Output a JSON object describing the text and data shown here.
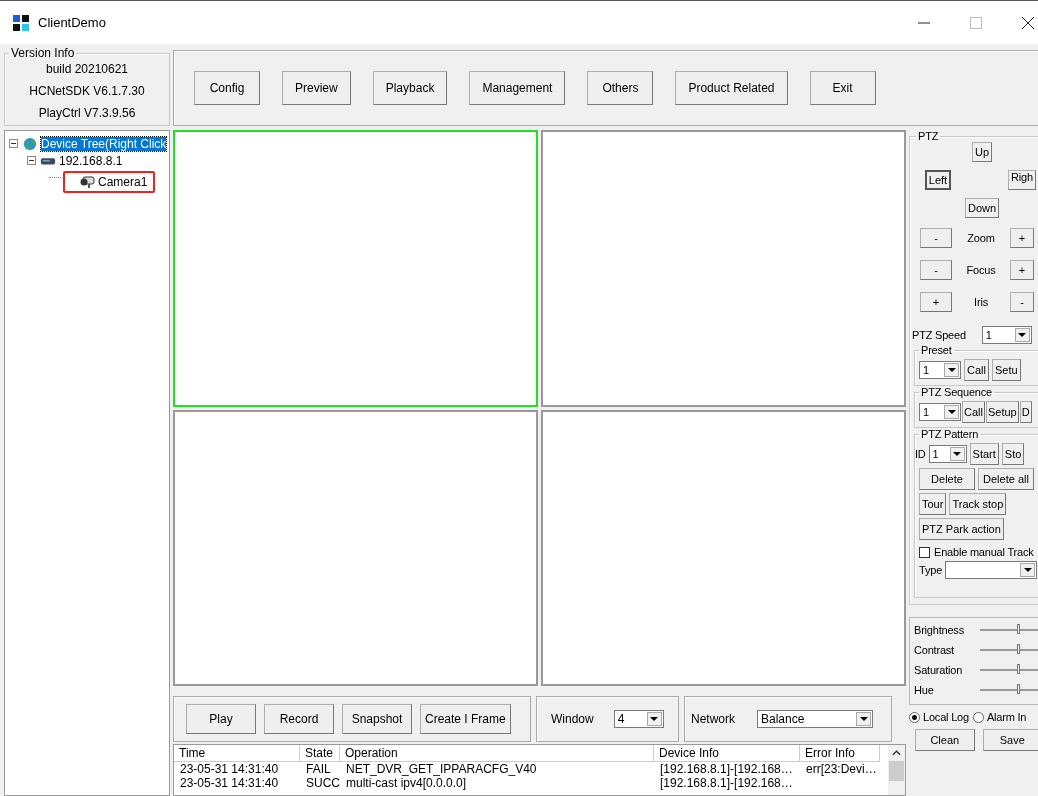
{
  "window": {
    "title": "ClientDemo"
  },
  "version_info": {
    "title": "Version Info",
    "lines": [
      "build 20210621",
      "HCNetSDK V6.1.7.30",
      "PlayCtrl V7.3.9.56"
    ]
  },
  "toolbar": [
    "Config",
    "Preview",
    "Playback",
    "Management",
    "Others",
    "Product Related",
    "Exit"
  ],
  "device_tree": [
    {
      "label": "Device Tree(Right Click",
      "kind": "root",
      "selected": true,
      "highlighted": false,
      "children": [
        {
          "label": "192.168.8.1",
          "kind": "device",
          "selected": false,
          "highlighted": false,
          "children": [
            {
              "label": "Camera1",
              "kind": "camera",
              "selected": false,
              "highlighted": true
            }
          ]
        }
      ]
    }
  ],
  "video_panes": [
    {
      "selected": true
    },
    {
      "selected": false
    },
    {
      "selected": false
    },
    {
      "selected": false
    }
  ],
  "preview_buttons": [
    "Play",
    "Record",
    "Snapshot",
    "Create I Frame"
  ],
  "window_select": {
    "label": "Window",
    "value": "4"
  },
  "network_select": {
    "label": "Network",
    "value": "Balance"
  },
  "log_table": {
    "columns": [
      "Time",
      "State",
      "Operation",
      "Device Info",
      "Error Info"
    ],
    "rows": [
      [
        "23-05-31 14:31:40",
        "FAIL",
        "NET_DVR_GET_IPPARACFG_V40",
        "[192.168.8.1]-[192.168…",
        "err[23:Devi…"
      ],
      [
        "23-05-31 14:31:40",
        "SUCC",
        "multi-cast ipv4[0.0.0.0]",
        "[192.168.8.1]-[192.168…",
        ""
      ]
    ]
  },
  "ptz": {
    "title": "PTZ",
    "directions": [
      {
        "label": "Up",
        "focused": false
      },
      {
        "label": "Left",
        "focused": true
      },
      {
        "label": "Righ",
        "focused": false
      },
      {
        "label": "Down",
        "focused": false
      }
    ],
    "adjust": [
      {
        "left": "-",
        "label": "Zoom",
        "right": "+"
      },
      {
        "left": "-",
        "label": "Focus",
        "right": "+"
      },
      {
        "left": "+",
        "label": "Iris",
        "right": "-"
      }
    ],
    "speed": {
      "label": "PTZ Speed",
      "value": "1"
    },
    "preset": {
      "title": "Preset",
      "value": "1",
      "buttons": [
        "Call",
        "Setu"
      ]
    },
    "sequence": {
      "title": "PTZ Sequence",
      "value": "1",
      "buttons": [
        "Call",
        "Setup",
        "D"
      ]
    },
    "pattern": {
      "title": "PTZ Pattern",
      "id_label": "ID",
      "value": "1",
      "row1": [
        "Start",
        "Sto"
      ],
      "row2": [
        "Delete",
        "Delete all"
      ],
      "row3": [
        "Tour",
        "Track stop"
      ],
      "park": "PTZ Park action",
      "manual": {
        "label": "Enable manual Track",
        "checked": false
      },
      "type_label": "Type"
    }
  },
  "image_sliders": [
    {
      "label": "Brightness",
      "level": 0.6
    },
    {
      "label": "Contrast",
      "level": 0.6
    },
    {
      "label": "Saturation",
      "level": 0.6
    },
    {
      "label": "Hue",
      "level": 0.6
    }
  ],
  "log_mode": [
    {
      "label": "Local Log",
      "selected": true
    },
    {
      "label": "Alarm In",
      "selected": false
    }
  ],
  "log_buttons": [
    "Clean",
    "Save"
  ]
}
